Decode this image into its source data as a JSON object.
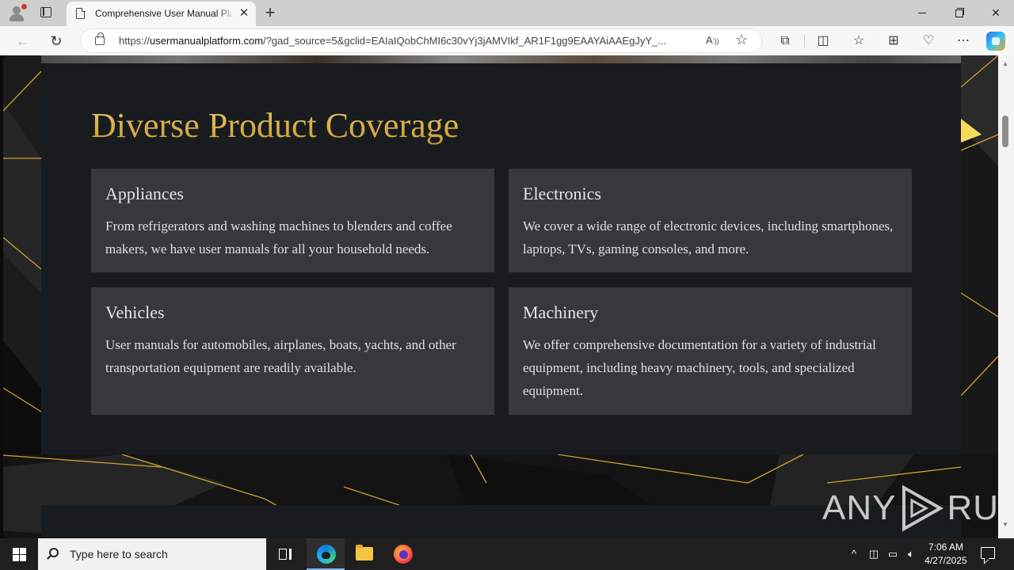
{
  "browser": {
    "tab_title": "Comprehensive User Manual Platform",
    "url_host": "usermanualplatform.com",
    "url_prefix": "https://",
    "url_rest": "/?gad_source=5&gclid=EAIaIQobChMI6c30vYj3jAMVIkf_AR1F1gg9EAAYAiAAEgJyY_...",
    "read_aloud_label": "A̅",
    "new_tab_glyph": "+"
  },
  "page": {
    "heading": "Diverse Product Coverage",
    "cards": [
      {
        "title": "Appliances",
        "text": "From refrigerators and washing machines to blenders and coffee makers, we have user manuals for all your household needs."
      },
      {
        "title": "Electronics",
        "text": "We cover a wide range of electronic devices, including smartphones, laptops, TVs, gaming consoles, and more."
      },
      {
        "title": "Vehicles",
        "text": "User manuals for automobiles, airplanes, boats, yachts, and other transportation equipment are readily available."
      },
      {
        "title": "Machinery",
        "text": "We offer comprehensive documentation for a variety of industrial equipment, including heavy machinery, tools, and specialized equipment."
      }
    ],
    "watermark_left": "ANY",
    "watermark_right": "RUN"
  },
  "taskbar": {
    "search_placeholder": "Type here to search",
    "time": "7:06 AM",
    "date": "4/27/2025"
  },
  "colors": {
    "heading_gold": "#d4ad47",
    "card_bg": "#35383c",
    "section_bg": "#191c1f"
  }
}
